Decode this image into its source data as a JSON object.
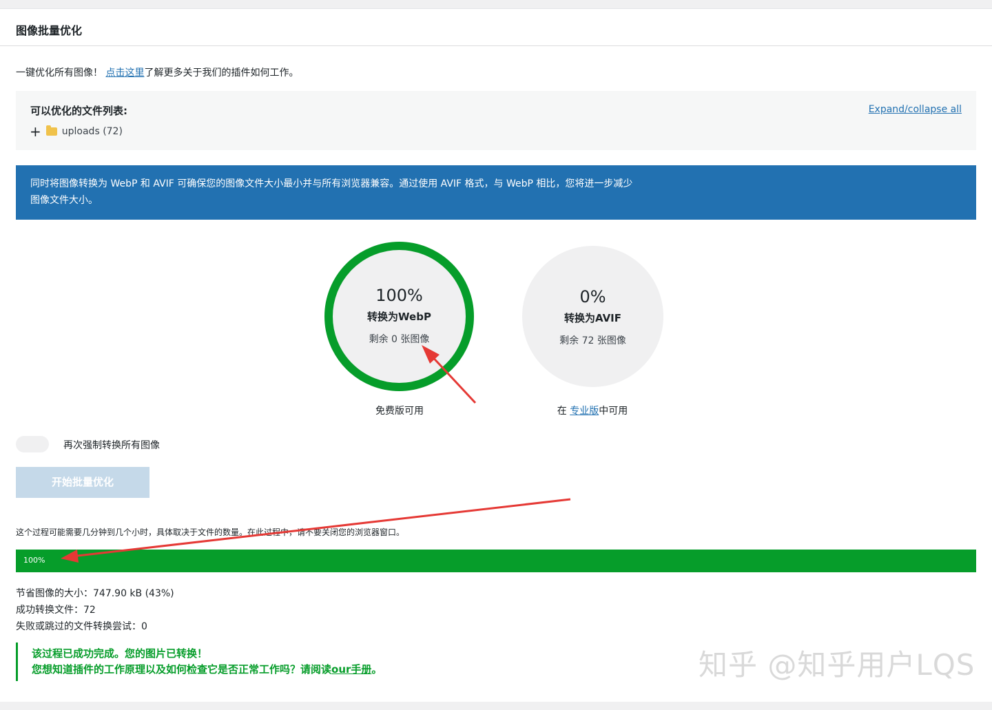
{
  "header": {
    "title": "图像批量优化"
  },
  "intro": {
    "before": "一键优化所有图像！",
    "link": "点击这里",
    "after": "了解更多关于我们的插件如何工作。"
  },
  "files": {
    "title": "可以优化的文件列表:",
    "expand_link": "Expand/collapse all",
    "tree": [
      {
        "plus": "+",
        "icon": "folder-icon",
        "label": "uploads (72)"
      }
    ]
  },
  "notice": {
    "text": "同时将图像转换为 WebP 和 AVIF 可确保您的图像文件大小最小并与所有浏览器兼容。通过使用 AVIF 格式，与 WebP 相比，您将进一步减少图像文件大小。"
  },
  "stats_circles": {
    "webp": {
      "percent": "100%",
      "label": "转换为WebP",
      "remaining": "剩余 0 张图像",
      "availability": "免费版可用",
      "color": "#069d2a"
    },
    "avif": {
      "percent": "0%",
      "label": "转换为AVIF",
      "remaining": "剩余 72 张图像",
      "availability_before": "在",
      "availability_link": "专业版",
      "availability_after": "中可用"
    }
  },
  "force": {
    "label": "再次强制转换所有图像"
  },
  "start_button": {
    "label": "开始批量优化"
  },
  "hint": "这个过程可能需要几分钟到几个小时，具体取决于文件的数量。在此过程中，请不要关闭您的浏览器窗口。",
  "progress": {
    "value": 1.0,
    "label": "100%",
    "color": "#069d2a"
  },
  "results": {
    "saved": "节省图像的大小：747.90 kB (43%)",
    "converted": "成功转换文件：72",
    "failed": "失败或跳过的文件转换尝试：0"
  },
  "success": {
    "line1": "该过程已成功完成。您的图片已转换！",
    "line2_before": "您想知道插件的工作原理以及如何检查它是否正常工作吗？请阅读",
    "line2_link": "our手册",
    "line2_after": "。"
  },
  "watermark": "知乎 @知乎用户LQS",
  "colors": {
    "accent": "#2271b1",
    "success": "#069d2a",
    "arrow": "#e53935"
  }
}
